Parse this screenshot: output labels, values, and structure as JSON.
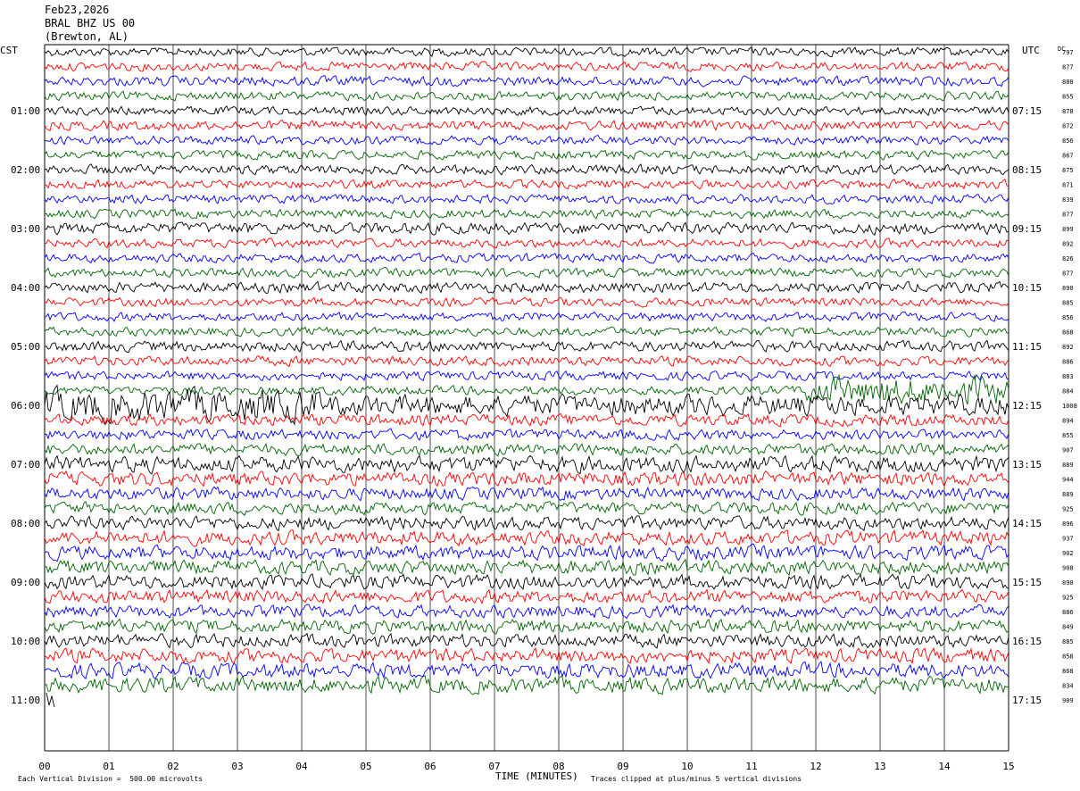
{
  "header": {
    "date": "Feb23,2026",
    "station": "BRAL BHZ US 00",
    "location": "(Brewton, AL)"
  },
  "axes": {
    "left_tz": "CST",
    "right_tz": "UTC",
    "dc_label": "DC",
    "x_title": "TIME (MINUTES)"
  },
  "footer": {
    "scale_note": "Each Vertical Division =  500.00 microvolts",
    "clip_note": "Traces clipped at plus/minus 5 vertical divisions"
  },
  "chart_data": {
    "type": "line",
    "title": "BRAL BHZ US 00",
    "xlabel": "TIME (MINUTES)",
    "ylabel": "",
    "x_ticks": [
      "00",
      "01",
      "02",
      "03",
      "04",
      "05",
      "06",
      "07",
      "08",
      "09",
      "10",
      "11",
      "12",
      "13",
      "14",
      "15"
    ],
    "xlim": [
      0,
      15
    ],
    "left_hour_labels": [
      "01:00",
      "02:00",
      "03:00",
      "04:00",
      "05:00",
      "06:00",
      "07:00",
      "08:00",
      "09:00",
      "10:00",
      "11:00"
    ],
    "right_hour_labels": [
      "07:15",
      "08:15",
      "09:15",
      "10:15",
      "11:15",
      "12:15",
      "13:15",
      "14:15",
      "15:15",
      "16:15",
      "17:15"
    ],
    "trace_colors": [
      "#000000",
      "#ff0000",
      "#0000ff",
      "#006400"
    ],
    "dc_offsets": [
      "797",
      "877",
      "880",
      "855",
      "878",
      "872",
      "856",
      "867",
      "875",
      "871",
      "839",
      "877",
      "899",
      "892",
      "826",
      "877",
      "890",
      "885",
      "856",
      "868",
      "892",
      "886",
      "883",
      "884",
      "1008",
      "894",
      "855",
      "907",
      "889",
      "944",
      "889",
      "925",
      "896",
      "937",
      "902",
      "908",
      "890",
      "925",
      "886",
      "849",
      "885",
      "858",
      "868",
      "834",
      "909"
    ],
    "trace_count": 44,
    "amplitude_per_trace": [
      1,
      1,
      1.1,
      1,
      1,
      1.1,
      1,
      1,
      1.1,
      1,
      1,
      1,
      1.3,
      1,
      1,
      1,
      1.2,
      1,
      1,
      1,
      1.2,
      1.1,
      1,
      1,
      2.3,
      1.3,
      1.2,
      1.3,
      1.8,
      1.6,
      1.4,
      1.4,
      1.5,
      1.6,
      1.6,
      1.6,
      1.6,
      1.5,
      1.4,
      1.5,
      1.5,
      1.6,
      1.7,
      1.8
    ],
    "scale_microvolts_per_division": 500,
    "clip_divisions": 5
  }
}
